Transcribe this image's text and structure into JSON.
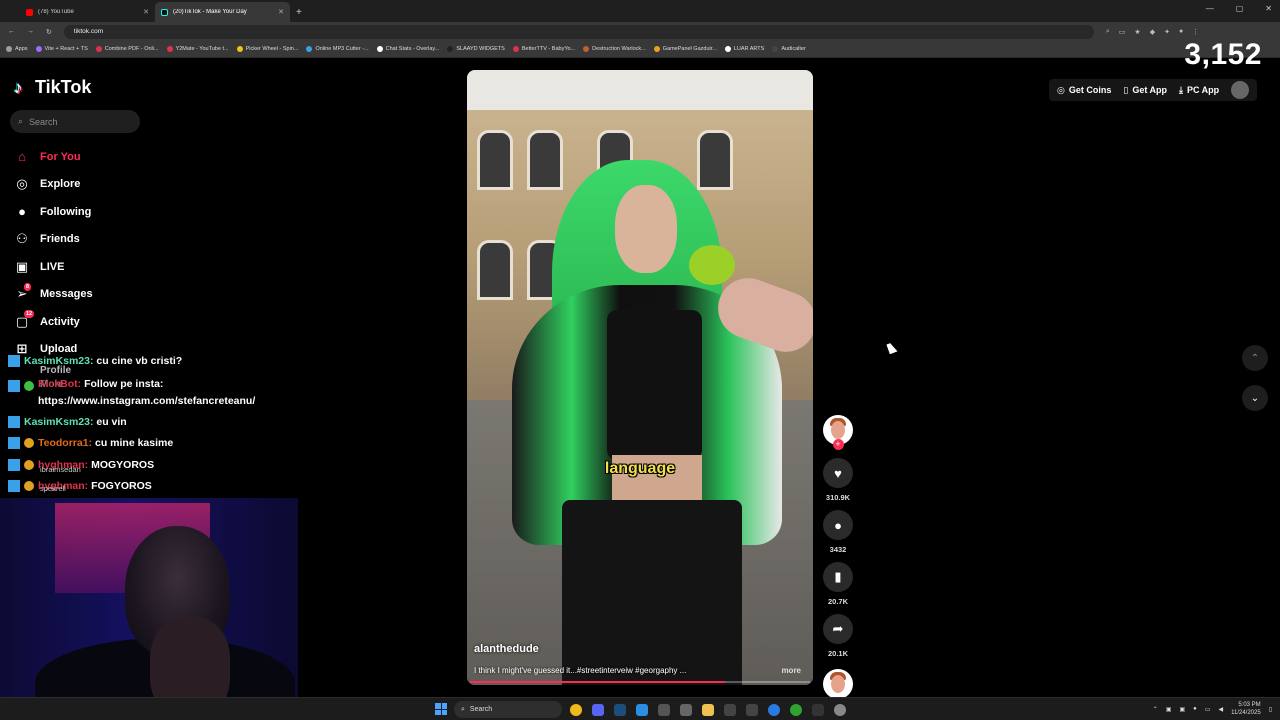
{
  "browser": {
    "tabs": [
      {
        "title": "(78) YouTube",
        "close": "✕",
        "color": "#ff0000"
      },
      {
        "title": "(20)TikTok - Make Your Day",
        "close": "✕",
        "color": "#111111"
      }
    ],
    "new_tab": "+",
    "url": "tiktok.com",
    "bookmarks": [
      {
        "label": "Apps",
        "color": "#9aa0a6"
      },
      {
        "label": "Vite + React + TS",
        "color": "#9b6cff"
      },
      {
        "label": "Combine PDF - Onli...",
        "color": "#e0324a"
      },
      {
        "label": "Y2Mate - YouTube t...",
        "color": "#e0324a"
      },
      {
        "label": "Picker Wheel - Spin...",
        "color": "#f0c419"
      },
      {
        "label": "Online MP3 Cutter -...",
        "color": "#3aa0e8"
      },
      {
        "label": "Chat Stats - Overlay...",
        "color": "#ffffff"
      },
      {
        "label": "SLAAYD WIDGETS",
        "color": "#222222"
      },
      {
        "label": "BetterTTV - BabyYo...",
        "color": "#e0324a"
      },
      {
        "label": "Destruction Warlock...",
        "color": "#c06030"
      },
      {
        "label": "GamePanel Gazduir...",
        "color": "#f0a020"
      },
      {
        "label": "LUAR ARTS",
        "color": "#ffffff"
      },
      {
        "label": "Audicalter",
        "color": "#444444"
      }
    ]
  },
  "overlay": {
    "viewer_count": "3,152"
  },
  "tiktok": {
    "logo": "TikTok",
    "search_placeholder": "Search",
    "nav": [
      {
        "label": "For You",
        "icon": "home-icon",
        "glyph": "⌂",
        "active": true
      },
      {
        "label": "Explore",
        "icon": "compass-icon",
        "glyph": "◎"
      },
      {
        "label": "Following",
        "icon": "following-avatar-icon",
        "glyph": "●"
      },
      {
        "label": "Friends",
        "icon": "friends-icon",
        "glyph": "⚇"
      },
      {
        "label": "LIVE",
        "icon": "live-icon",
        "glyph": "▣"
      },
      {
        "label": "Messages",
        "icon": "messages-icon",
        "glyph": "➢",
        "badge": "8"
      },
      {
        "label": "Activity",
        "icon": "activity-icon",
        "glyph": "▢",
        "badge": "12"
      },
      {
        "label": "Upload",
        "icon": "upload-icon",
        "glyph": "⊞"
      }
    ],
    "nav_faded": [
      "Profile",
      "More"
    ],
    "header": {
      "get_coins": "Get Coins",
      "get_app": "Get App",
      "pc_app": "PC App"
    },
    "video": {
      "caption_word": "language",
      "author": "alanthedude",
      "description": "I think I might've guessed it...#streetinterveiw #georgaphy ...",
      "more": "more",
      "progress": 0.75
    },
    "actions": {
      "likes": "310.9K",
      "comments": "3432",
      "saves": "20.7K",
      "shares": "20.1K"
    }
  },
  "chat": [
    {
      "user": "KasimKsm23:",
      "text": " cu cine vb cristi?",
      "style": "green"
    },
    {
      "user": "KickBot:",
      "text": " Follow pe insta: https://www.instagram.com/stefancreteanu/",
      "style": "red"
    },
    {
      "user": "KasimKsm23:",
      "text": " eu vin",
      "style": "green"
    },
    {
      "user": "Teodorra1:",
      "text": " cu mine kasime",
      "style": "orange"
    },
    {
      "user": "hyghman:",
      "text": " MOGYOROS",
      "style": "red"
    },
    {
      "user": "hyghman:",
      "text": " FOGYOROS",
      "style": "red"
    }
  ],
  "chat_ghost": [
    "ibraimsedan",
    "spekrell"
  ],
  "taskbar": {
    "search": "Search",
    "time": "5:03 PM",
    "date": "11/24/2025"
  }
}
